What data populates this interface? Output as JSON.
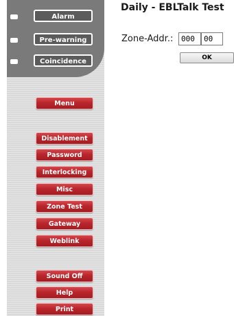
{
  "status": {
    "items": [
      {
        "label": "Alarm"
      },
      {
        "label": "Pre-warning"
      },
      {
        "label": "Coincidence"
      }
    ]
  },
  "nav": {
    "menu_label": "Menu",
    "group1": [
      {
        "label": "Disablement"
      },
      {
        "label": "Password"
      },
      {
        "label": "Interlocking"
      },
      {
        "label": "Misc"
      },
      {
        "label": "Zone Test"
      },
      {
        "label": "Gateway"
      },
      {
        "label": "Weblink"
      }
    ],
    "group2": [
      {
        "label": "Sound Off"
      },
      {
        "label": "Help"
      },
      {
        "label": "Print"
      }
    ]
  },
  "main": {
    "title": "Daily - EBLTalk Test",
    "zone_label": "Zone-Addr.:",
    "zone_value": "000",
    "addr_value": "00",
    "ok_label": "OK"
  },
  "colors": {
    "status_panel": "#7a7a7a",
    "status_button": "#5b5b5b",
    "menu_button": "#b9262c",
    "sidebar": "#d9d9d9"
  }
}
